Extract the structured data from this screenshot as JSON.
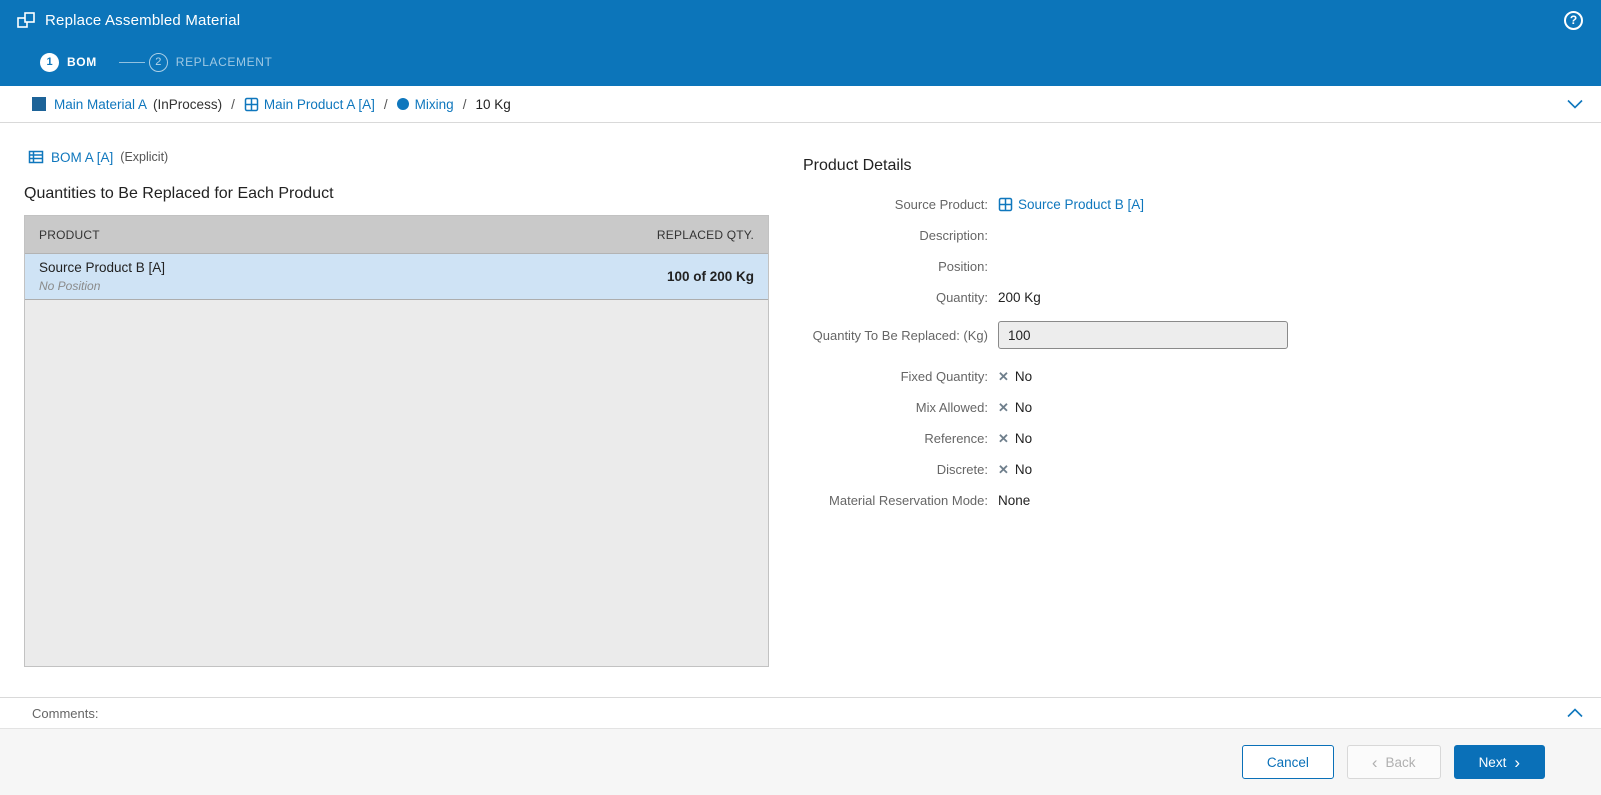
{
  "header": {
    "title": "Replace Assembled Material"
  },
  "icons": {
    "help": "?",
    "x_mark": "✕",
    "back_chevron": "‹",
    "next_chevron": "›"
  },
  "wizard": {
    "step1": {
      "number": "1",
      "label": "BOM"
    },
    "step2": {
      "number": "2",
      "label": "REPLACEMENT"
    }
  },
  "breadcrumb": {
    "material": "Main Material A",
    "material_status": "(InProcess)",
    "separator": "/",
    "product": "Main Product A [A]",
    "operation": "Mixing",
    "quantity": "10 Kg"
  },
  "bom": {
    "name": "BOM A [A]",
    "type": "(Explicit)"
  },
  "left": {
    "section_title": "Quantities to Be Replaced for Each Product",
    "table": {
      "col_product": "PRODUCT",
      "col_replaced": "REPLACED QTY.",
      "row": {
        "product": "Source Product B [A]",
        "position": "No Position",
        "replaced_qty": "100 of 200 Kg"
      }
    }
  },
  "details": {
    "title": "Product Details",
    "source_product_label": "Source Product:",
    "source_product_value": "Source Product B [A]",
    "description_label": "Description:",
    "description_value": "",
    "position_label": "Position:",
    "position_value": "",
    "quantity_label": "Quantity:",
    "quantity_value": "200 Kg",
    "qty_replace_label": "Quantity To Be Replaced: (Kg)",
    "qty_replace_value": "100",
    "fixed_label": "Fixed Quantity:",
    "fixed_value": "No",
    "mix_label": "Mix Allowed:",
    "mix_value": "No",
    "reference_label": "Reference:",
    "reference_value": "No",
    "discrete_label": "Discrete:",
    "discrete_value": "No",
    "reservation_label": "Material Reservation Mode:",
    "reservation_value": "None"
  },
  "comments": {
    "label": "Comments:"
  },
  "footer": {
    "cancel": "Cancel",
    "back": "Back",
    "next": "Next"
  }
}
